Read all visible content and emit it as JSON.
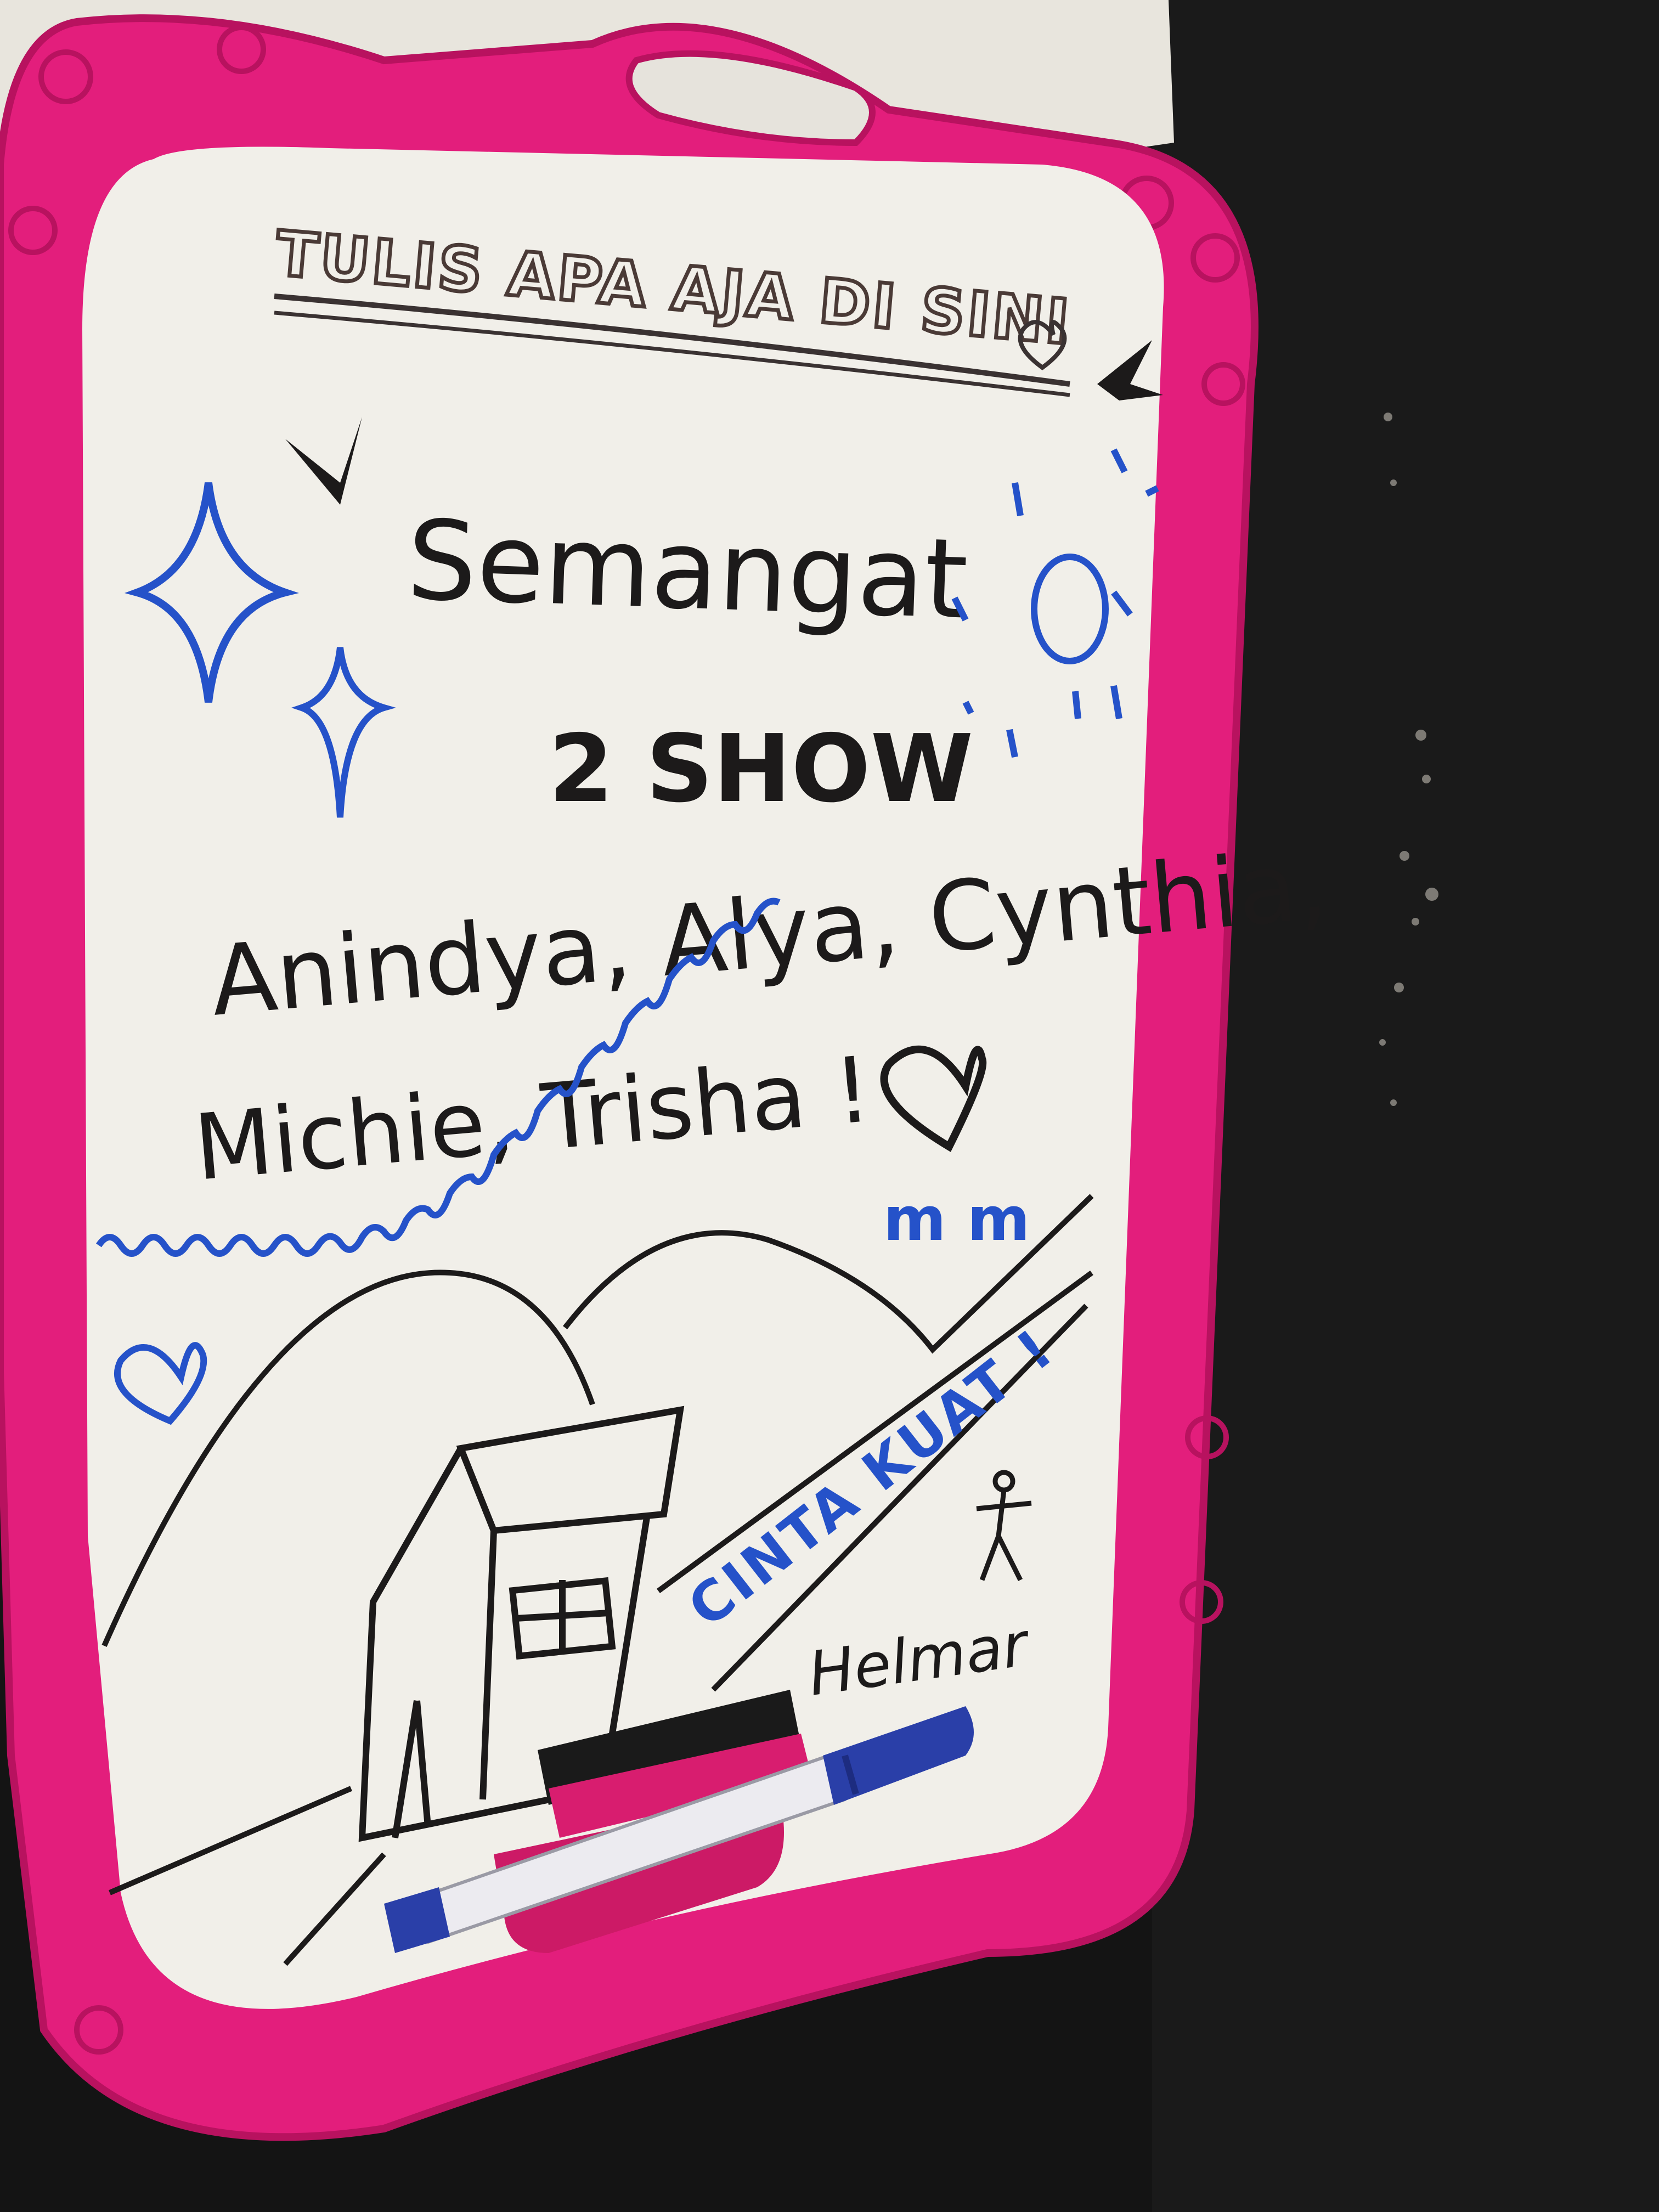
{
  "board": {
    "header": "TULIS APA AJA DI SINI",
    "line1": "Semangat",
    "line2": "2 SHOW",
    "line3": "Anindya, Alya, Cynthia,",
    "line4": "Michie, Trisha !",
    "slogan": "CINTA KUAT !",
    "signature": "Helmar"
  },
  "colors": {
    "frame": "#e31e7c",
    "frame_dark": "#b8125f",
    "board": "#f1efe9",
    "black_ink": "#1c1a1a",
    "blue_ink": "#2552c9",
    "background": "#141414",
    "wall": "#e9e6df"
  },
  "icons": [
    "heart-icon",
    "sparkle-icon",
    "sun-icon",
    "bird-icon",
    "house-icon",
    "stick-figure-icon",
    "marker-icon",
    "eraser-icon"
  ]
}
